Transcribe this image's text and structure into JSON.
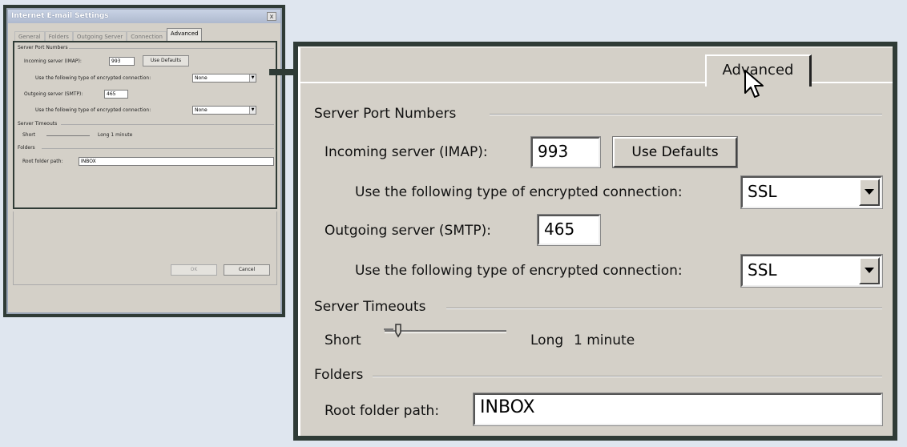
{
  "thumbnail": {
    "title": "Internet E-mail Settings",
    "close_glyph": "x",
    "tabs": [
      "General",
      "Folders",
      "Outgoing Server",
      "Connection",
      "Advanced"
    ],
    "server_port_numbers_label": "Server Port Numbers",
    "incoming_label": "Incoming server (IMAP):",
    "incoming_value": "993",
    "use_defaults": "Use Defaults",
    "encryption_label": "Use the following type of encrypted connection:",
    "encryption_in_value": "None",
    "outgoing_label": "Outgoing server (SMTP):",
    "outgoing_value": "465",
    "encryption_out_value": "None",
    "server_timeouts_label": "Server Timeouts",
    "short_label": "Short",
    "long_label": "Long  1 minute",
    "folders_label": "Folders",
    "root_folder_label": "Root folder path:",
    "root_folder_value": "INBOX",
    "ok": "OK",
    "cancel": "Cancel"
  },
  "zoom": {
    "active_tab": "Advanced",
    "server_port_numbers": "Server Port Numbers",
    "incoming_label": "Incoming server (IMAP):",
    "incoming_value": "993",
    "use_defaults": "Use Defaults",
    "encryption_label_1": "Use the following type of encrypted connection:",
    "encryption_value_1": "SSL",
    "outgoing_label": "Outgoing server (SMTP):",
    "outgoing_value": "465",
    "encryption_label_2": "Use the following type of encrypted connection:",
    "encryption_value_2": "SSL",
    "server_timeouts": "Server Timeouts",
    "short_label": "Short",
    "long_label": "Long",
    "timeout_value": "1 minute",
    "timeout_level": 0.07,
    "folders": "Folders",
    "root_folder_label": "Root folder path:",
    "root_folder_value": "INBOX"
  },
  "colors": {
    "frame": "#2f3b36",
    "dialog_bg": "#d4d0c8",
    "page_bg": "#dfe6ef"
  }
}
